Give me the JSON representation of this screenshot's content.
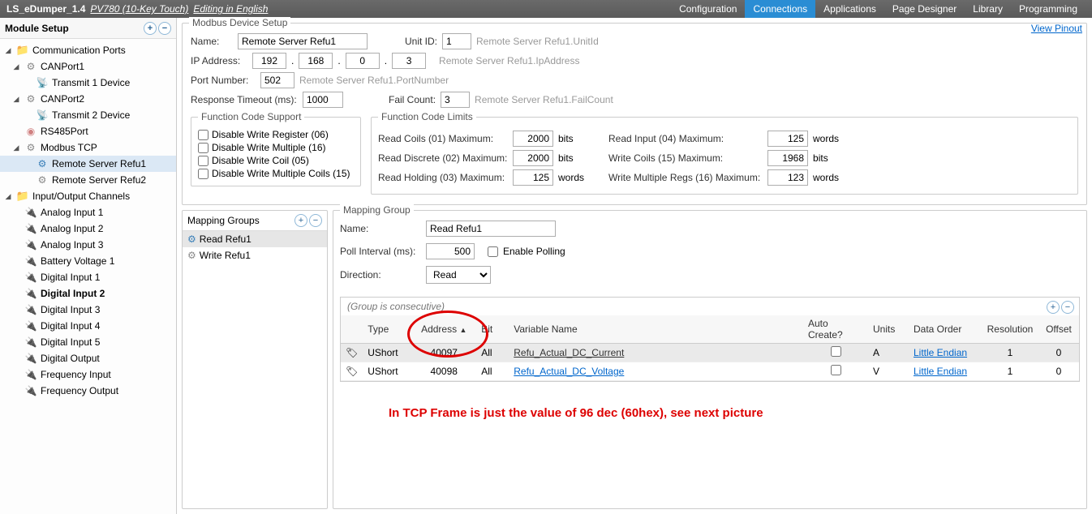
{
  "topbar": {
    "app": "LS_eDumper_1.4",
    "device": "PV780 (10-Key Touch)",
    "mode": "Editing in English",
    "menu": [
      "Configuration",
      "Connections",
      "Applications",
      "Page Designer",
      "Library",
      "Programming"
    ],
    "active": "Connections"
  },
  "sidebar": {
    "title": "Module Setup",
    "tree": {
      "comm_ports": "Communication Ports",
      "can1": "CANPort1",
      "tx1": "Transmit 1 Device",
      "can2": "CANPort2",
      "tx2": "Transmit 2 Device",
      "rs485": "RS485Port",
      "modbus": "Modbus TCP",
      "refu1": "Remote Server Refu1",
      "refu2": "Remote Server Refu2",
      "io": "Input/Output Channels",
      "ai1": "Analog Input 1",
      "ai2": "Analog Input 2",
      "ai3": "Analog Input 3",
      "bv1": "Battery Voltage 1",
      "di1": "Digital Input 1",
      "di2": "Digital Input 2",
      "di3": "Digital Input 3",
      "di4": "Digital Input 4",
      "di5": "Digital Input 5",
      "do": "Digital Output",
      "fi": "Frequency Input",
      "fo": "Frequency Output"
    }
  },
  "device": {
    "title": "Modbus Device Setup",
    "view_pinout": "View Pinout",
    "name_lbl": "Name:",
    "name": "Remote Server Refu1",
    "unitid_lbl": "Unit ID:",
    "unitid": "1",
    "unitid_hint": "Remote Server Refu1.UnitId",
    "ip_lbl": "IP Address:",
    "ip": [
      "192",
      "168",
      "0",
      "3"
    ],
    "ip_hint": "Remote Server Refu1.IpAddress",
    "port_lbl": "Port Number:",
    "port": "502",
    "port_hint": "Remote Server Refu1.PortNumber",
    "rt_lbl": "Response Timeout (ms):",
    "rt": "1000",
    "fc_lbl": "Fail Count:",
    "fc": "3",
    "fc_hint": "Remote Server Refu1.FailCount",
    "fcs": {
      "title": "Function Code Support",
      "opts": [
        "Disable Write Register (06)",
        "Disable Write Multiple (16)",
        "Disable Write Coil (05)",
        "Disable Write Multiple Coils (15)"
      ]
    },
    "fcl": {
      "title": "Function Code Limits",
      "rows": [
        {
          "lbl": "Read Coils (01) Maximum:",
          "val": "2000",
          "unit": "bits"
        },
        {
          "lbl": "Read Discrete (02) Maximum:",
          "val": "2000",
          "unit": "bits"
        },
        {
          "lbl": "Read Holding (03) Maximum:",
          "val": "125",
          "unit": "words"
        }
      ],
      "rows2": [
        {
          "lbl": "Read Input (04) Maximum:",
          "val": "125",
          "unit": "words"
        },
        {
          "lbl": "Write Coils (15) Maximum:",
          "val": "1968",
          "unit": "bits"
        },
        {
          "lbl": "Write Multiple Regs (16) Maximum:",
          "val": "123",
          "unit": "words"
        }
      ]
    }
  },
  "mgroups": {
    "title": "Mapping Groups",
    "items": [
      "Read Refu1",
      "Write Refu1"
    ]
  },
  "mgroup": {
    "title": "Mapping Group",
    "name_lbl": "Name:",
    "name": "Read Refu1",
    "poll_lbl": "Poll Interval (ms):",
    "poll": "500",
    "enable_poll": "Enable Polling",
    "dir_lbl": "Direction:",
    "dir": "Read",
    "note": "(Group is consecutive)",
    "cols": [
      "Type",
      "Address",
      "Bit",
      "Variable Name",
      "Auto Create?",
      "Units",
      "Data Order",
      "Resolution",
      "Offset"
    ],
    "rows": [
      {
        "type": "UShort",
        "addr": "40097",
        "bit": "All",
        "var": "Refu_Actual_DC_Current",
        "units": "A",
        "order": "Little Endian",
        "res": "1",
        "off": "0"
      },
      {
        "type": "UShort",
        "addr": "40098",
        "bit": "All",
        "var": "Refu_Actual_DC_Voltage",
        "units": "V",
        "order": "Little Endian",
        "res": "1",
        "off": "0"
      }
    ]
  },
  "annotation": "In TCP Frame is just the value of 96 dec (60hex), see next picture"
}
